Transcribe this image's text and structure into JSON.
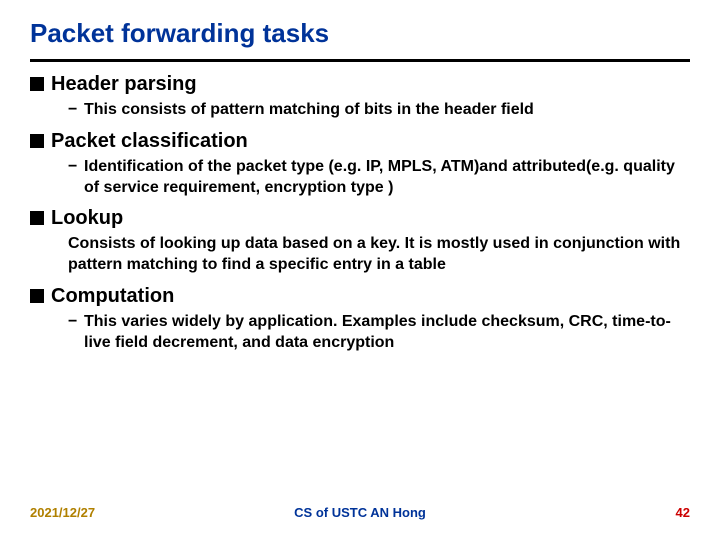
{
  "title": "Packet forwarding tasks",
  "items": [
    {
      "heading": "Header parsing",
      "sub_with_dash": true,
      "sub": "This consists of pattern matching of bits in the header field"
    },
    {
      "heading": "Packet classification",
      "sub_with_dash": true,
      "sub": "Identification of the packet type (e.g. IP, MPLS, ATM)and attributed(e.g. quality of service requirement, encryption type )"
    },
    {
      "heading": "Lookup",
      "sub_with_dash": false,
      "sub": "Consists of looking up data based on a key. It is mostly used in conjunction with pattern matching to find a specific entry in a table"
    },
    {
      "heading": "Computation",
      "sub_with_dash": true,
      "sub": "This varies widely by application. Examples include checksum, CRC, time-to-live field decrement, and data encryption"
    }
  ],
  "footer": {
    "date": "2021/12/27",
    "center": "CS of USTC AN Hong",
    "page": "42"
  }
}
